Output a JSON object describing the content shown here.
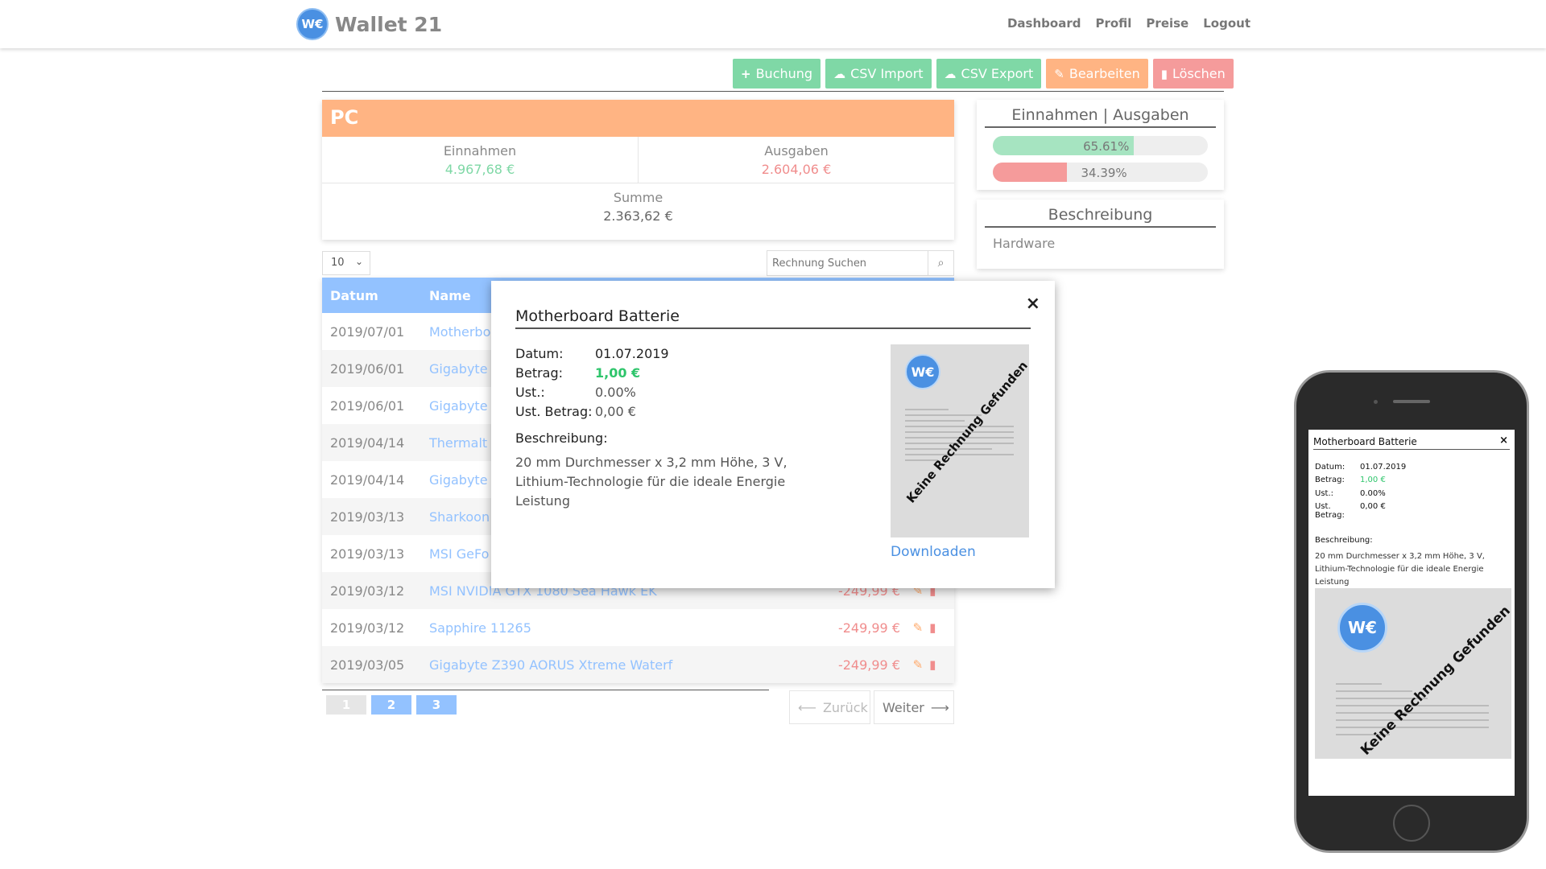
{
  "brand": {
    "logo_text": "W€",
    "name": "Wallet 21"
  },
  "nav": [
    "Dashboard",
    "Profil",
    "Preise",
    "Logout"
  ],
  "toolbar": {
    "buchung": "Buchung",
    "csv_import": "CSV Import",
    "csv_export": "CSV Export",
    "bearbeiten": "Bearbeiten",
    "loeschen": "Löschen"
  },
  "summary": {
    "title": "PC",
    "income_label": "Einnahmen",
    "income_value": "4.967,68 €",
    "expense_label": "Ausgaben",
    "expense_value": "2.604,06 €",
    "sum_label": "Summe",
    "sum_value": "2.363,62 €"
  },
  "ratio": {
    "title": "Einnahmen | Ausgaben",
    "income_pct": "65.61%",
    "income_fraction": 0.6561,
    "expense_pct": "34.39%",
    "expense_fraction": 0.3439
  },
  "description_card": {
    "title": "Beschreibung",
    "text": "Hardware"
  },
  "table_controls": {
    "page_length": "10",
    "search_placeholder": "Rechnung Suchen"
  },
  "table": {
    "headers": {
      "date": "Datum",
      "name": "Name"
    },
    "rows": [
      {
        "date": "2019/07/01",
        "name": "Motherboard Batterie",
        "amount": ""
      },
      {
        "date": "2019/06/01",
        "name": "Gigabyte",
        "amount": ""
      },
      {
        "date": "2019/06/01",
        "name": "Gigabyte",
        "amount": ""
      },
      {
        "date": "2019/04/14",
        "name": "Thermalt",
        "amount": ""
      },
      {
        "date": "2019/04/14",
        "name": "Gigabyte",
        "amount": ""
      },
      {
        "date": "2019/03/13",
        "name": "Sharkoon",
        "amount": ""
      },
      {
        "date": "2019/03/13",
        "name": "MSI GeFo",
        "amount": ""
      },
      {
        "date": "2019/03/12",
        "name": "MSI NVIDIA GTX 1080 Sea Hawk EK",
        "amount": "-249,99 €"
      },
      {
        "date": "2019/03/12",
        "name": "Sapphire 11265",
        "amount": "-249,99 €"
      },
      {
        "date": "2019/03/05",
        "name": "Gigabyte Z390 AORUS Xtreme Waterf",
        "amount": "-249,99 €"
      }
    ]
  },
  "pagination": {
    "pages": [
      "1",
      "2",
      "3"
    ],
    "prev": "Zurück",
    "next": "Weiter"
  },
  "modal": {
    "title": "Motherboard Batterie",
    "close": "×",
    "datum_label": "Datum:",
    "datum": "01.07.2019",
    "betrag_label": "Betrag:",
    "betrag": "1,00 €",
    "ust_label": "Ust.:",
    "ust": "0.00%",
    "ust_betrag_label": "Ust. Betrag:",
    "ust_betrag": "0,00 €",
    "beschreibung_label": "Beschreibung:",
    "beschreibung": "20 mm Durchmesser x 3,2 mm Höhe, 3 V, Lithium-Technologie für die ideale Energie Leistung",
    "receipt_stamp": "Keine Rechnung Gefunden",
    "download": "Downloaden"
  },
  "phone": {
    "title": "Motherboard Batterie",
    "close": "×",
    "datum_label": "Datum:",
    "datum": "01.07.2019",
    "betrag_label": "Betrag:",
    "betrag": "1,00 €",
    "ust_label": "Ust.:",
    "ust": "0.00%",
    "ust_betrag_label": "Ust. Betrag:",
    "ust_betrag": "0,00 €",
    "beschreibung_label": "Beschreibung:",
    "beschreibung": "20 mm Durchmesser x 3,2 mm Höhe, 3 V, Lithium-Technologie für die ideale Energie Leistung",
    "receipt_stamp": "Keine Rechnung Gefunden"
  },
  "colors": {
    "green": "#7fd8a6",
    "orange": "#ffb483",
    "red": "#f59b9b",
    "blue": "#93c2ff"
  }
}
